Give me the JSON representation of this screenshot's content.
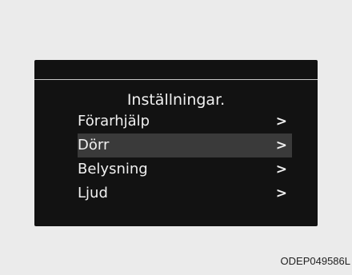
{
  "screen": {
    "title": "Inställningar.",
    "items": [
      {
        "label": "Förarhjälp",
        "arrow": ">"
      },
      {
        "label": "Dörr",
        "arrow": ">"
      },
      {
        "label": "Belysning",
        "arrow": ">"
      },
      {
        "label": "Ljud",
        "arrow": ">"
      }
    ],
    "selected_index": 1
  },
  "image_code": "ODEP049586L",
  "colors": {
    "background": "#ebebeb",
    "display": "#121212",
    "highlight": "#3a3a3a",
    "text": "#f0f0f0"
  }
}
